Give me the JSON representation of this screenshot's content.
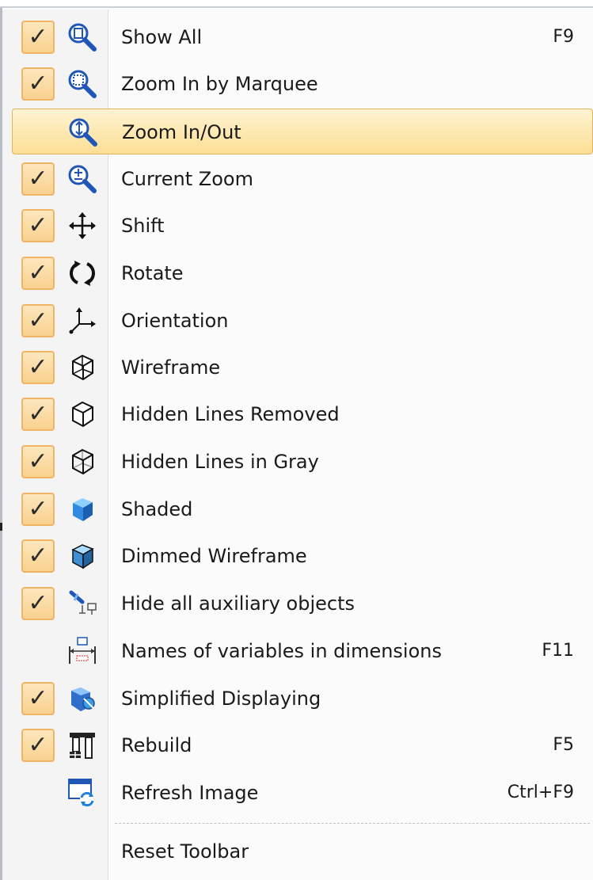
{
  "menu": {
    "items": [
      {
        "label": "Show All",
        "shortcut": "F9",
        "checked": true,
        "icon": "magnifier-page-icon"
      },
      {
        "label": "Zoom In by Marquee",
        "shortcut": "",
        "checked": true,
        "icon": "magnifier-marquee-icon"
      },
      {
        "label": "Zoom In/Out",
        "shortcut": "",
        "checked": false,
        "hovered": true,
        "icon": "magnifier-updown-icon"
      },
      {
        "label": "Current Zoom",
        "shortcut": "",
        "checked": true,
        "icon": "magnifier-plusminus-icon"
      },
      {
        "label": "Shift",
        "shortcut": "",
        "checked": true,
        "icon": "move-arrows-icon"
      },
      {
        "label": "Rotate",
        "shortcut": "",
        "checked": true,
        "icon": "rotate-arrows-icon"
      },
      {
        "label": "Orientation",
        "shortcut": "",
        "checked": true,
        "icon": "axes-orientation-icon"
      },
      {
        "label": "Wireframe",
        "shortcut": "",
        "checked": true,
        "icon": "wireframe-cube-icon"
      },
      {
        "label": "Hidden Lines Removed",
        "shortcut": "",
        "checked": true,
        "icon": "hidden-lines-cube-icon"
      },
      {
        "label": "Hidden Lines in Gray",
        "shortcut": "",
        "checked": true,
        "icon": "gray-lines-cube-icon"
      },
      {
        "label": "Shaded",
        "shortcut": "",
        "checked": true,
        "icon": "shaded-cube-icon"
      },
      {
        "label": "Dimmed Wireframe",
        "shortcut": "",
        "checked": true,
        "icon": "dimmed-cube-icon"
      },
      {
        "label": "Hide all auxiliary objects",
        "shortcut": "",
        "checked": true,
        "icon": "auxiliary-objects-icon"
      },
      {
        "label": "Names of variables in dimensions",
        "shortcut": "F11",
        "checked": false,
        "icon": "dimension-variables-icon"
      },
      {
        "label": "Simplified Displaying",
        "shortcut": "",
        "checked": true,
        "icon": "simplified-display-icon"
      },
      {
        "label": "Rebuild",
        "shortcut": "F5",
        "checked": true,
        "icon": "rebuild-icon"
      },
      {
        "label": "Refresh Image",
        "shortcut": "Ctrl+F9",
        "checked": false,
        "icon": "refresh-image-icon"
      }
    ],
    "reset_label": "Reset Toolbar",
    "check_glyph": "✓"
  },
  "colors": {
    "check_fill": "#f9d18f",
    "check_border": "#f1b465",
    "hover_fill": "#fbdf95",
    "icon_blue": "#1f56b8",
    "shaded_blue": "#2f8ae0"
  }
}
